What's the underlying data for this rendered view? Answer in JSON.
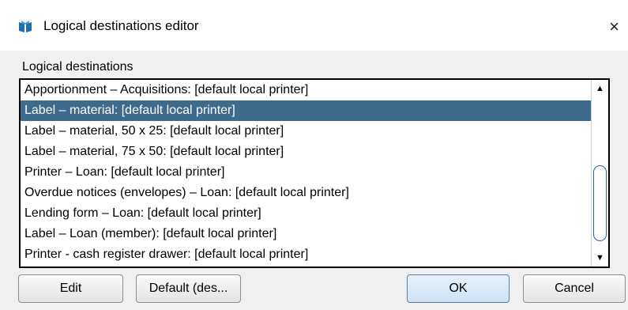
{
  "window": {
    "title": "Logical destinations editor",
    "close_glyph": "×",
    "app_icon": "book-icon"
  },
  "group": {
    "label": "Logical destinations"
  },
  "list": {
    "selected_index": 1,
    "items": [
      "Apportionment – Acquisitions: [default local printer]",
      "Label – material: [default local printer]",
      "Label – material, 50 x 25: [default local printer]",
      "Label – material, 75 x 50: [default local printer]",
      "Printer – Loan: [default local printer]",
      "Overdue notices (envelopes) – Loan: [default local printer]",
      "Lending form – Loan: [default local printer]",
      "Label – Loan (member): [default local printer]",
      "Printer - cash register drawer: [default local printer]"
    ],
    "scroll_up_glyph": "▲",
    "scroll_down_glyph": "▼"
  },
  "buttons": {
    "edit": "Edit",
    "default": "Default (des...",
    "ok": "OK",
    "cancel": "Cancel"
  },
  "colors": {
    "selection": "#3e6b8c",
    "dialog_bg": "#f0f0f0"
  }
}
